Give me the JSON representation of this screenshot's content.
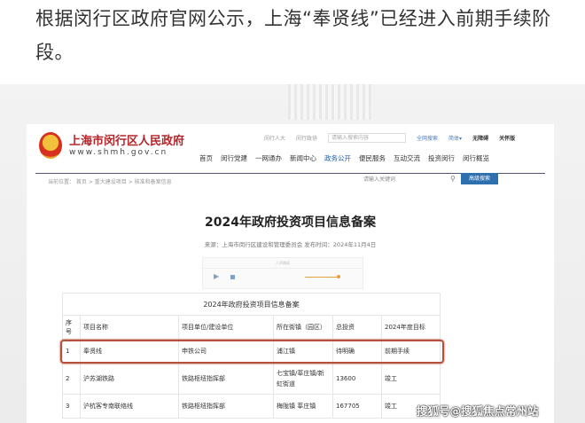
{
  "article": {
    "text": "根据闵行区政府官网公示，上海“奉贤线”已经进入前期手续阶段。"
  },
  "site": {
    "name": "上海市闵行区人民政府",
    "url": "www.shmh.gov.cn",
    "top_links": [
      "闵行人大",
      "闵行政协"
    ],
    "search_placeholder": "请输入搜索内容",
    "site_search": "全网搜索",
    "lang": "简体▾",
    "accessible": "无障碍",
    "care": "关怀版",
    "nav": [
      "首页",
      "闵行党建",
      "一网通办",
      "新闻中心",
      "政务公开",
      "便民服务",
      "互动交流",
      "投资闵行",
      "闵行概览"
    ],
    "breadcrumb": "当前位置： 首页 > 重大建设项目 > 核准和备案信息",
    "keyword_placeholder": "请输入关键词",
    "advanced_search": "高级搜索"
  },
  "doc": {
    "title": "2024年政府投资项目信息备案",
    "source": "来源：上海市闵行区建设和管理委员会  发布时间：2024年11月4日",
    "player_caption": "人声朗读",
    "table_caption": "2024年政府投资项目信息备案",
    "headers": [
      "序号",
      "项目名称",
      "项目单位/建设单位",
      "所在街镇（园区）",
      "总投资",
      "2024年度目标"
    ],
    "rows": [
      [
        "1",
        "奉贤线",
        "申铁公司",
        "浦江镇",
        "待明确",
        "前期手续"
      ],
      [
        "2",
        "沪苏湖铁路",
        "铁路枢纽指挥部",
        "七宝镇/莘庄镇/新虹街道",
        "13600",
        "竣工"
      ],
      [
        "3",
        "沪杭客专南联络线",
        "铁路枢纽指挥部",
        "梅陇镇  莘庄镇",
        "167705",
        "竣工"
      ]
    ]
  },
  "watermark": "搜狐号@搜狐焦点常州站",
  "colors": {
    "highlight": "#b5503a",
    "nav_active": "#1d5da8",
    "brand_red": "#b3252a"
  }
}
